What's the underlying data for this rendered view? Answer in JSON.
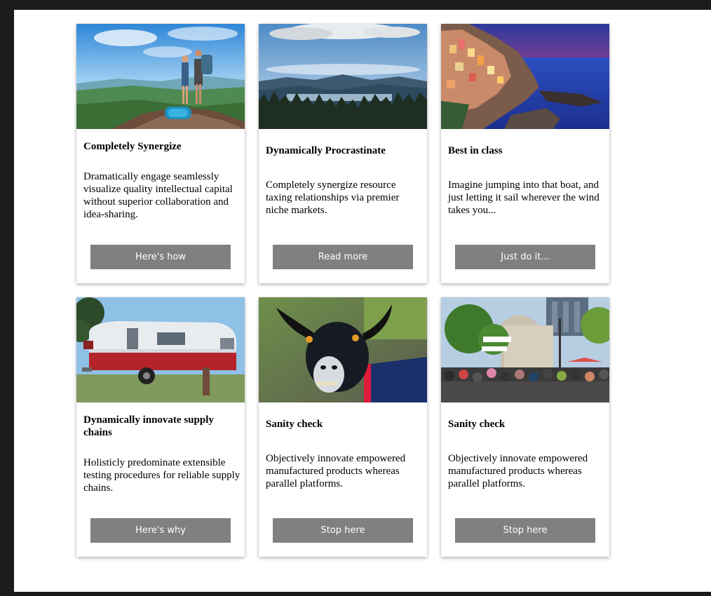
{
  "colors": {
    "frame": "#1c1c1e",
    "page_background": "#ffffff",
    "button_background": "#808080",
    "button_text": "#ffffff"
  },
  "cards": [
    {
      "image": "travelers-on-mountain-peak",
      "title": "Completely Synergize",
      "body": "Dramatically engage seamlessly visualize quality intellectual capital without superior collaboration and idea-sharing.",
      "button": "Here's how"
    },
    {
      "image": "mountain-lake-forest",
      "title": "Dynamically Procrastinate",
      "body": "Completely synergize resource taxing relationships via premier niche markets.",
      "button": "Read more"
    },
    {
      "image": "coastal-village-at-dusk",
      "title": "Best in class",
      "body": "Imagine jumping into that boat, and just letting it sail wherever the wind takes you...",
      "button": "Just do it..."
    },
    {
      "image": "vintage-camper-trailer",
      "title": "Dynamically innovate supply chains",
      "body": "Holisticly predominate extensible testing procedures for reliable supply chains.",
      "button": "Here's why"
    },
    {
      "image": "black-goat",
      "title": "Sanity check",
      "body": "Objectively innovate empowered manufactured products whereas parallel platforms.",
      "button": "Stop here"
    },
    {
      "image": "crowded-street-festival",
      "title": "Sanity check",
      "body": "Objectively innovate empowered manufactured products whereas parallel platforms.",
      "button": "Stop here"
    }
  ]
}
